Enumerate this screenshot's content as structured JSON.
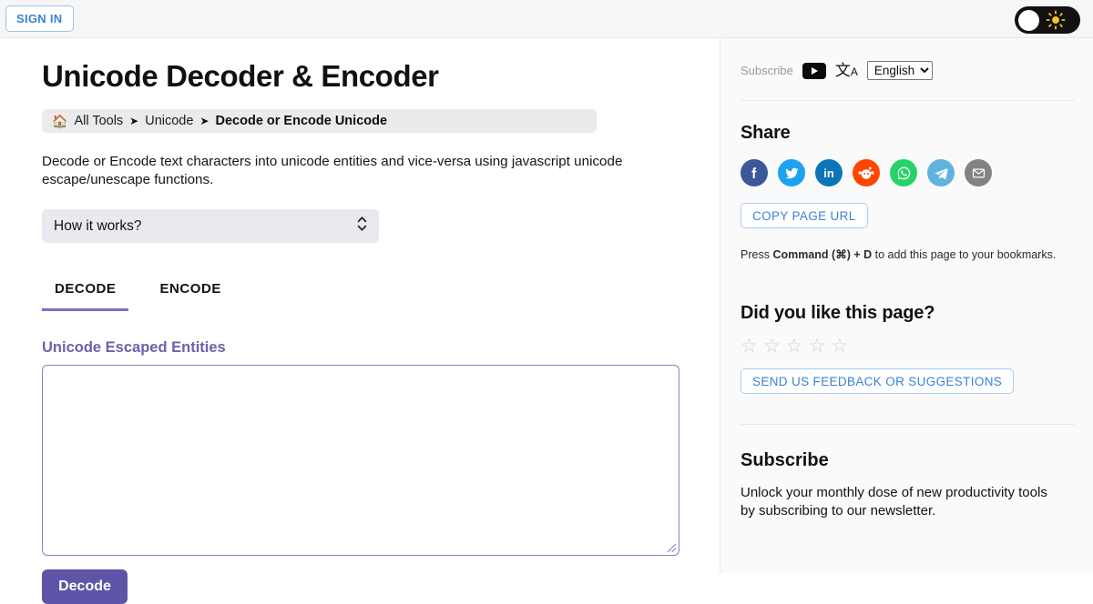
{
  "topbar": {
    "signin_label": "SIGN IN",
    "theme_toggle_name": "light-dark-mode-toggle",
    "sun_icon": "sun-icon"
  },
  "main": {
    "title": "Unicode Decoder & Encoder",
    "breadcrumb": {
      "home_icon": "home-icon",
      "items": [
        "All Tools",
        "Unicode"
      ],
      "separator": "➤",
      "current": "Decode or Encode Unicode"
    },
    "description": "Decode or Encode text characters into unicode entities and vice-versa using javascript unicode escape/unescape functions.",
    "accordion": {
      "label": "How it works?",
      "chevron_icon": "chevron-up-down-icon"
    },
    "tabs": [
      {
        "label": "DECODE",
        "active": true
      },
      {
        "label": "ENCODE",
        "active": false
      }
    ],
    "field": {
      "label": "Unicode Escaped Entities",
      "value": "",
      "placeholder": ""
    },
    "submit_label": "Decode"
  },
  "sidebar": {
    "subscribe_row": {
      "label": "Subscribe",
      "youtube_icon": "youtube-icon",
      "translate_icon": "translate-icon",
      "language_selected": "English",
      "language_options": [
        "English"
      ]
    },
    "share": {
      "heading": "Share",
      "networks": [
        {
          "name": "facebook",
          "glyph": "f",
          "color": "#3b5998"
        },
        {
          "name": "twitter",
          "glyph": "🐦",
          "color": "#1da1f2"
        },
        {
          "name": "linkedin",
          "glyph": "in",
          "color": "#0b76b7"
        },
        {
          "name": "reddit",
          "glyph": "👽",
          "color": "#ff4500"
        },
        {
          "name": "whatsapp",
          "glyph": "✆",
          "color": "#25d366"
        },
        {
          "name": "telegram",
          "glyph": "➤",
          "color": "#5fb3e0"
        },
        {
          "name": "email",
          "glyph": "✉",
          "color": "#828282"
        }
      ],
      "copy_url_label": "COPY PAGE URL",
      "bookmark_hint_pre": "Press ",
      "bookmark_hint_key": "Command (⌘) + D",
      "bookmark_hint_post": " to add this page to your bookmarks."
    },
    "rating": {
      "heading": "Did you like this page?",
      "stars_total": 5,
      "stars_filled": 0,
      "star_glyph": "☆",
      "feedback_label": "SEND US FEEDBACK OR SUGGESTIONS"
    },
    "newsletter": {
      "heading": "Subscribe",
      "text": "Unlock your monthly dose of new productivity tools by subscribing to our newsletter."
    }
  },
  "colors": {
    "accent_purple": "#5e55a8",
    "link_blue": "#3b82d6",
    "tab_underline": "#7a6fc4"
  }
}
